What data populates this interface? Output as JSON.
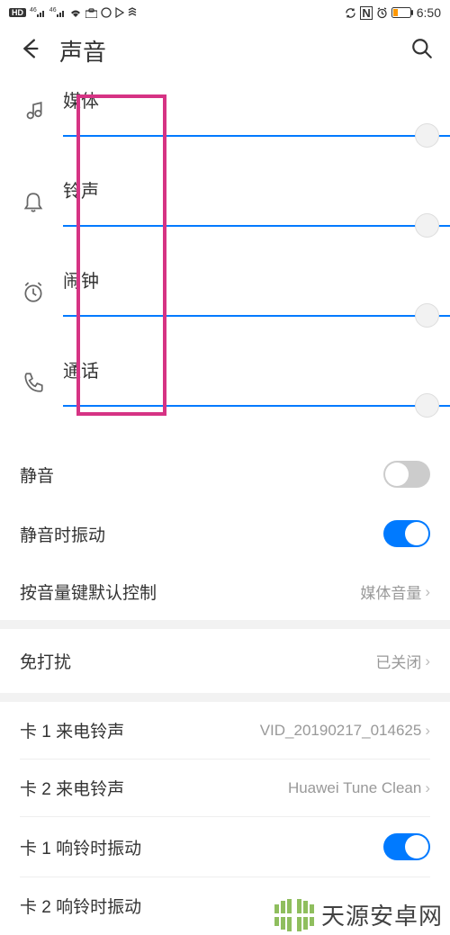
{
  "status": {
    "hd": "HD",
    "sig1": "46",
    "sig2": "46",
    "time": "6:50"
  },
  "header": {
    "title": "声音"
  },
  "sliders": {
    "media": {
      "label": "媒体"
    },
    "ringtone": {
      "label": "铃声"
    },
    "alarm": {
      "label": "闹钟"
    },
    "call": {
      "label": "通话"
    }
  },
  "settings": {
    "mute": {
      "label": "静音"
    },
    "vibrate_on_mute": {
      "label": "静音时振动"
    },
    "volume_key": {
      "label": "按音量键默认控制",
      "value": "媒体音量"
    },
    "dnd": {
      "label": "免打扰",
      "value": "已关闭"
    },
    "sim1_ringtone": {
      "label": "卡 1 来电铃声",
      "value": "VID_20190217_014625"
    },
    "sim2_ringtone": {
      "label": "卡 2 来电铃声",
      "value": "Huawei Tune Clean"
    },
    "sim1_vibrate": {
      "label": "卡 1 响铃时振动"
    },
    "sim2_vibrate": {
      "label": "卡 2 响铃时振动"
    }
  },
  "watermark": {
    "text": "天源安卓网"
  }
}
